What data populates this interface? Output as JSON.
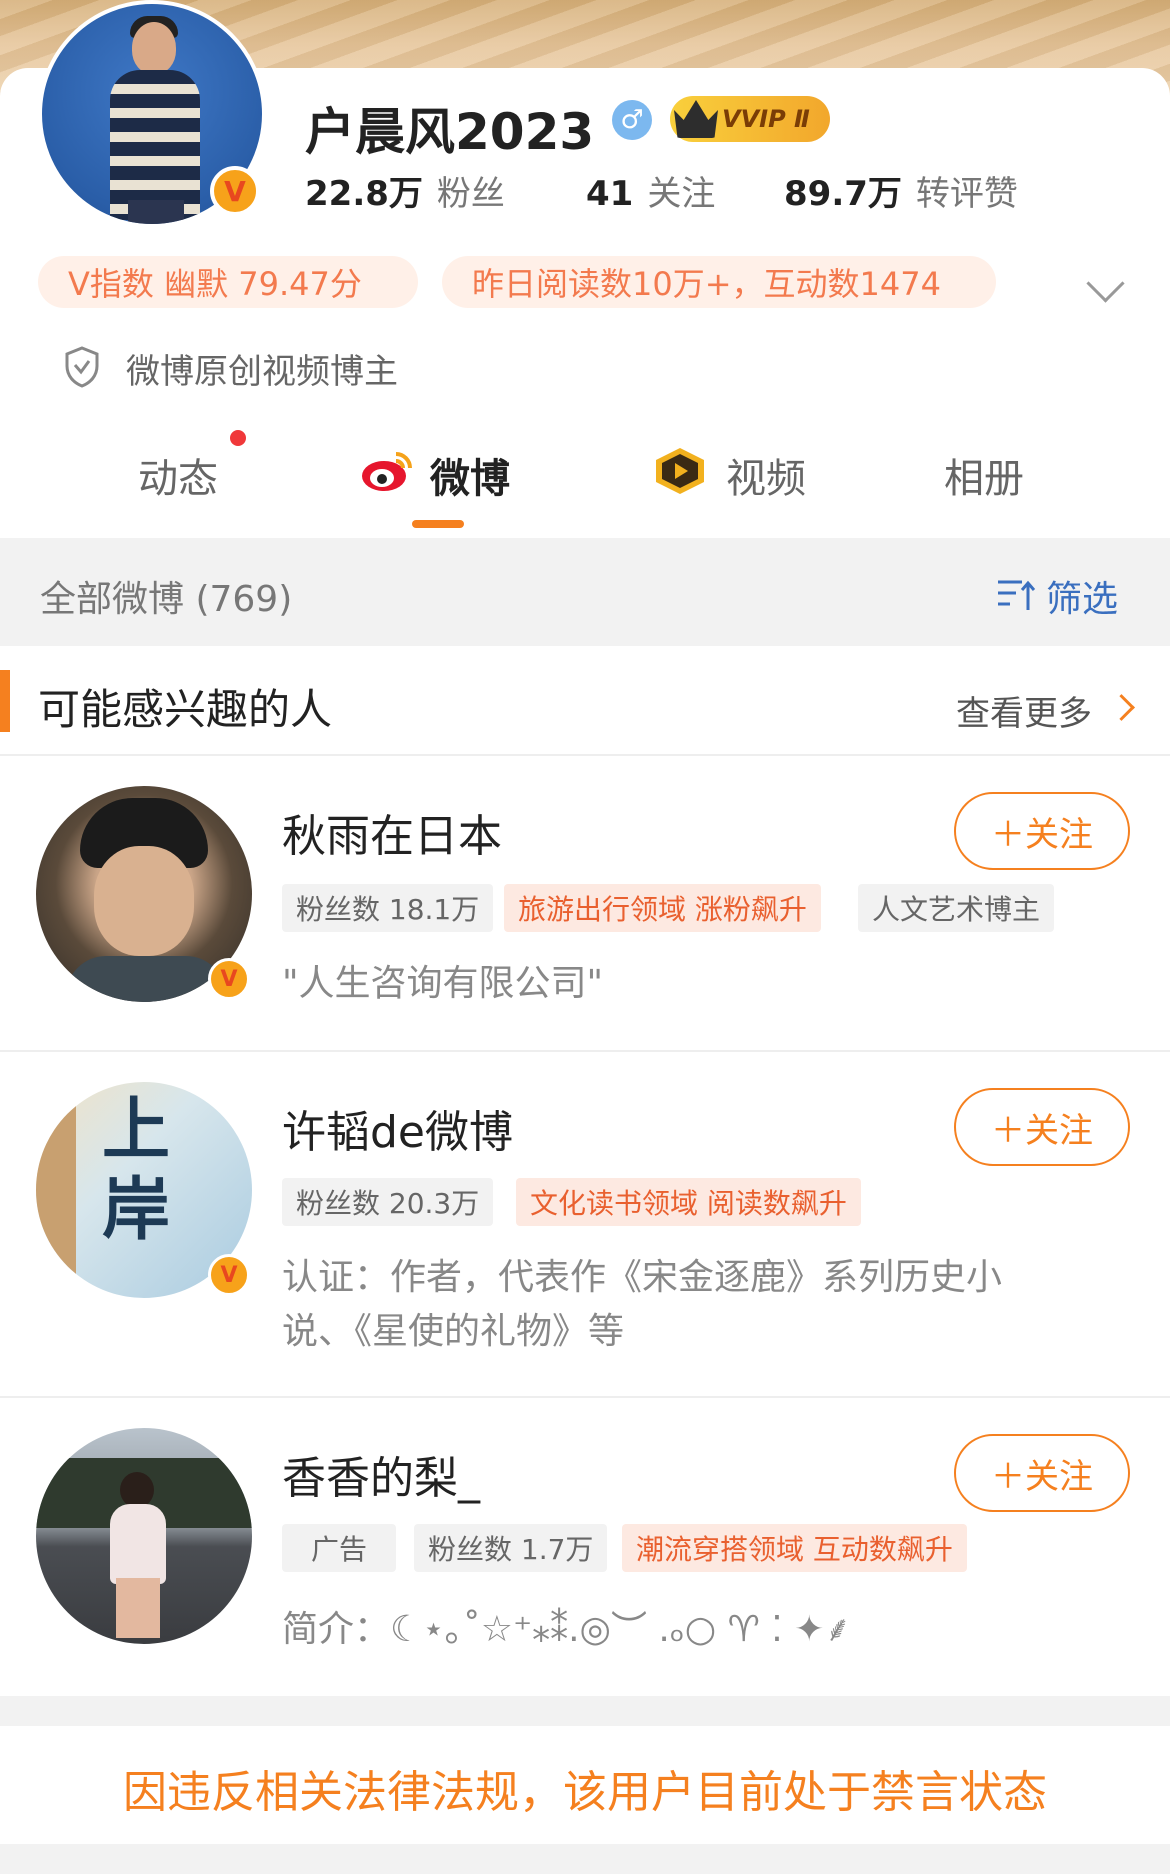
{
  "profile": {
    "name": "户晨风2023",
    "gender_icon": "male-icon",
    "vip_label": "VVIP Ⅱ",
    "fans_count": "22.8万",
    "fans_label": "粉丝",
    "follow_count": "41",
    "follow_label": "关注",
    "likes_count": "89.7万",
    "likes_label": "转评赞",
    "v_index": "V指数 幽默 79.47分",
    "read_stats": "昨日阅读数10万+，互动数1474",
    "certification": "微博原创视频博主"
  },
  "tabs": [
    {
      "label": "动态"
    },
    {
      "label": "微博"
    },
    {
      "label": "视频"
    },
    {
      "label": "相册"
    }
  ],
  "filter": {
    "all_label": "全部微博 (769)",
    "filter_label": "筛选"
  },
  "recommend": {
    "title": "可能感兴趣的人",
    "see_more": "查看更多",
    "follow_label": "＋关注",
    "people": [
      {
        "name": "秋雨在日本",
        "tags": [
          "粉丝数 18.1万",
          "旅游出行领域 涨粉飙升",
          "人文艺术博主"
        ],
        "desc": "\"人生咨询有限公司\""
      },
      {
        "name": "许韬de微博",
        "tags": [
          "粉丝数 20.3万",
          "文化读书领域 阅读数飙升"
        ],
        "desc_line1": "认证：作者，代表作《宋金逐鹿》系列历史小",
        "desc_line2": "说、《星使的礼物》等",
        "avatar_text": "上岸"
      },
      {
        "name": "香香的梨_",
        "tags": [
          "广告",
          "粉丝数 1.7万",
          "潮流穿搭领域 互动数飙升"
        ],
        "desc": "简介：☾⋆｡˚☆⁺⁎⁑.◎︶ .ₒ○ ♈ ⁚ ✦⸙"
      }
    ]
  },
  "banned_notice": "因违反相关法律法规，该用户目前处于禁言状态",
  "colors": {
    "accent": "#f5801f",
    "link_blue": "#3a6fbf",
    "tag_orange_bg": "#fde9e1",
    "tag_orange_text": "#e9602f"
  }
}
